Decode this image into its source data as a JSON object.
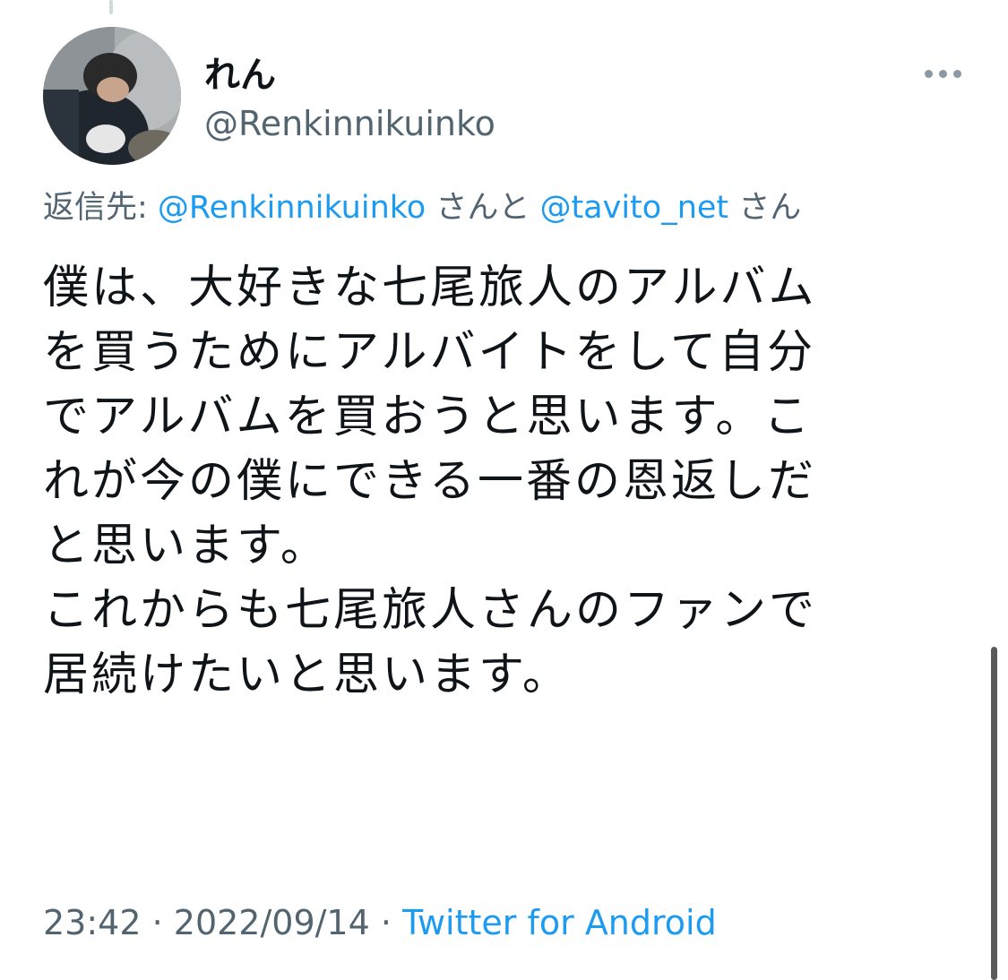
{
  "author": {
    "display_name": "れん",
    "handle": "@Renkinnikuinko"
  },
  "reply": {
    "prefix": "返信先: ",
    "mention_1": "@Renkinnikuinko",
    "joiner": " さんと ",
    "mention_2": "@tavito_net",
    "suffix": " さん"
  },
  "tweet": {
    "lines": [
      "僕は、大好きな七尾旅人のアルバム",
      "を買うためにアルバイトをして自分",
      "でアルバムを買おうと思います。こ",
      "れが今の僕にできる一番の恩返しだ",
      "と思います。",
      "これからも七尾旅人さんのファンで",
      "居続けたいと思います。"
    ]
  },
  "meta": {
    "time": "23:42",
    "separator": " · ",
    "date": "2022/09/14",
    "source": "Twitter for Android"
  },
  "icons": {
    "more": "more-horizontal-icon",
    "avatar": "profile-photo"
  },
  "colors": {
    "text": "#0f1419",
    "secondary": "#536471",
    "link": "#1d9bf0"
  }
}
